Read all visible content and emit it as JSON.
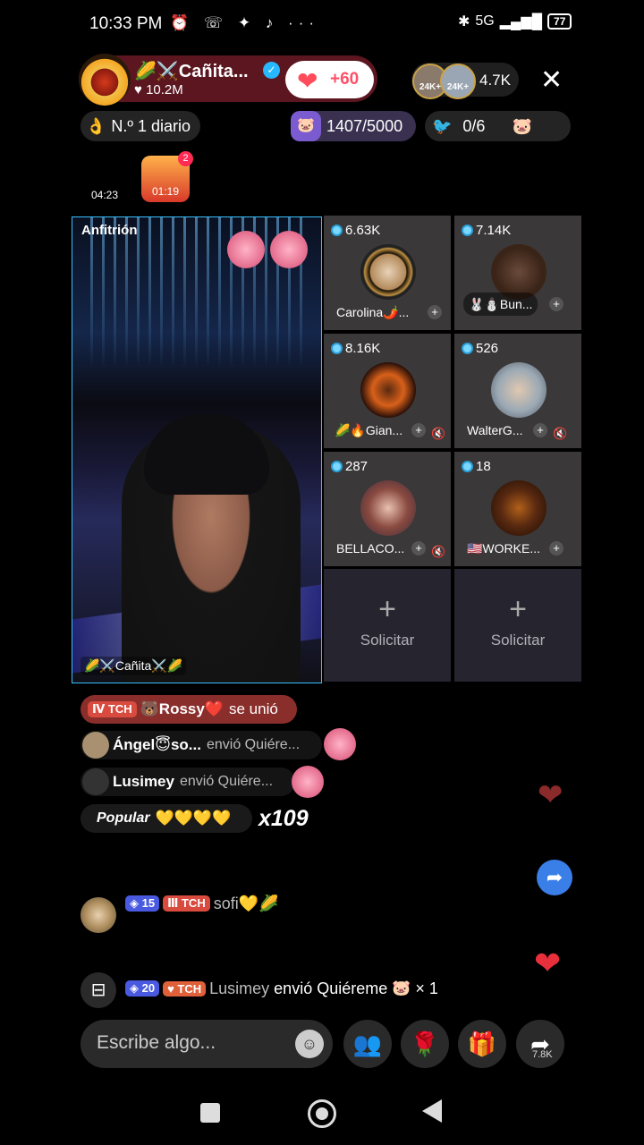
{
  "status_bar": {
    "time": "10:33 PM",
    "icons": "⏰ ☏ ✦ ♪ ···",
    "network": "5G",
    "battery": "77"
  },
  "host": {
    "name": "🌽⚔️Cañita...",
    "likes": "10.2M",
    "follow_count": "+60",
    "viewer_count": "4.7K",
    "viewer_badges": [
      "24K+",
      "24K+"
    ]
  },
  "top_row": {
    "rank": "N.º 1 diario",
    "goal": "1407/5000",
    "goal2": "0/6"
  },
  "treasure": {
    "timer": "04:23",
    "chest_time": "01:19",
    "badge": "2"
  },
  "host_video": {
    "label": "Anfitrión",
    "name": "🌽⚔️Cañita⚔️🌽"
  },
  "guests": [
    {
      "score": "6.63K",
      "name": "Carolina🌶️...",
      "muted": false
    },
    {
      "score": "7.14K",
      "name": "🐰⛄Bun...",
      "muted": false
    },
    {
      "score": "8.16K",
      "name": "🌽🔥Gian...",
      "muted": true
    },
    {
      "score": "526",
      "name": "WalterG...",
      "muted": true
    },
    {
      "score": "287",
      "name": "BELLACO...",
      "muted": true
    },
    {
      "score": "18",
      "name": "🇺🇸WORKE...",
      "muted": false
    }
  ],
  "request_label": "Solicitar",
  "chat": {
    "joined": {
      "tag": "Ⅳ TCH",
      "user": "🐻Rossy❤️",
      "text": "se unió"
    },
    "gift1": {
      "user": "Ángel😇so...",
      "text": "envió Quiére..."
    },
    "gift2": {
      "user": "Lusimey",
      "text": "envió Quiére..."
    },
    "popular": {
      "label": "Popular",
      "hearts": "💛💛💛💛",
      "combo": "x109"
    },
    "msg1": {
      "level": "15",
      "tag": "TCH",
      "text": "sofi💛🌽"
    },
    "msg2": {
      "level": "20",
      "tag": "TCH",
      "user": "Lusimey",
      "text": "envió Quiéreme",
      "count": "× 1"
    }
  },
  "bottom_bar": {
    "placeholder": "Escribe algo...",
    "share_count": "7.8K"
  },
  "icons": {
    "close": "close-icon",
    "share": "share-icon",
    "gift": "gift-icon",
    "rose": "rose-icon",
    "guests": "guests-icon",
    "emoji": "emoji-icon"
  },
  "colors": {
    "accent": "#ff4b5a",
    "tile": "#3a3838",
    "tag_red": "#d94b3f",
    "verified": "#27b7ff"
  }
}
